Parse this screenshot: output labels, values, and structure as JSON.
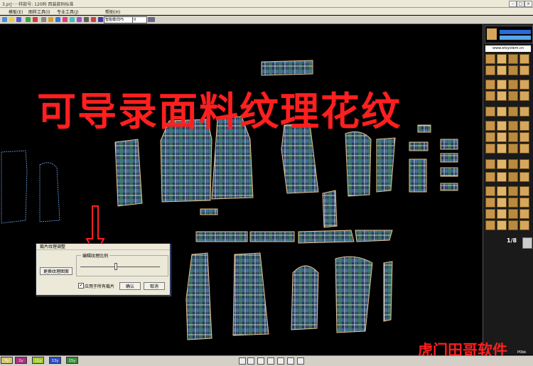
{
  "window": {
    "title": "3.prj·····样款号: 120码 西装款码标准"
  },
  "menu": [
    "模板(E)",
    "图样工具(I)",
    "专业工具(J)",
    "帮助(H)"
  ],
  "toolbar": {
    "mode_value": "智能模式P5",
    "zoom_value": "0"
  },
  "banner": {
    "text": "可导录面料纹理花纹"
  },
  "watermark": {
    "text": "虎门田哥软件"
  },
  "right_panel": {
    "site": "www.etsystem.cn",
    "fraction": "1/8"
  },
  "dialog": {
    "title": "裁片纹理调整",
    "replace_button": "更换纹理图案",
    "group_label": "编辑纹理比例",
    "checkbox_label": "应用于所有裁片",
    "checkbox_checked": "✔",
    "ok_button": "确认",
    "cancel_button": "取消",
    "slider_level": 0.45
  },
  "statusbar": {
    "swatches": [
      {
        "label": "7y",
        "color": "#d4c873"
      },
      {
        "label": "2y",
        "color": "#a83280"
      },
      {
        "label": "11y",
        "color": "#a2c834"
      },
      {
        "label": "13y",
        "color": "#2e4fc2"
      },
      {
        "label": "15y",
        "color": "#3c8c3c"
      }
    ],
    "right_text": "P0bk"
  },
  "colors": {
    "banner": "#ff1f1f",
    "piece_outline": "#e8c08a",
    "fabric_dark": "#1d2e4a",
    "fabric_green": "#3e7d52"
  }
}
